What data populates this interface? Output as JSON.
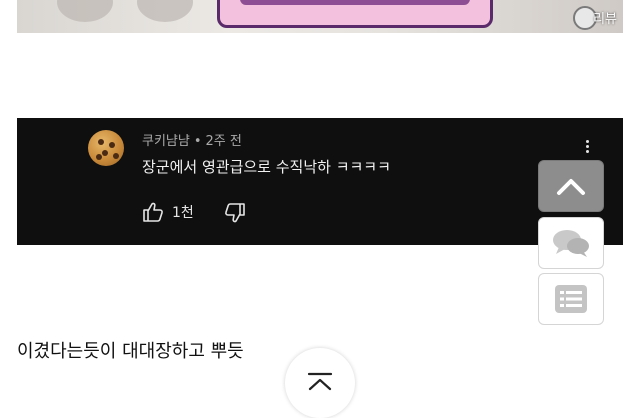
{
  "thumbnail": {
    "corner_text": "리뷰"
  },
  "comment": {
    "author": "쿠키냠냠",
    "separator": "•",
    "time": "2주 전",
    "text": "장군에서 영관급으로 수직낙하 ㅋㅋㅋㅋ",
    "likes": "1천",
    "avatar_icon": "cookie-avatar",
    "menu_icon": "more-vert-icon",
    "like_icon": "thumb-up-icon",
    "dislike_icon": "thumb-down-icon"
  },
  "side_buttons": [
    {
      "icon": "chevron-up-icon"
    },
    {
      "icon": "chat-bubbles-icon"
    },
    {
      "icon": "list-icon"
    }
  ],
  "caption": "이겼다는듯이 대대장하고 뿌듯",
  "scroll_top_icon": "double-chevron-up-icon",
  "colors": {
    "panel_bg": "#0f0f0f",
    "meta_text": "#aaaaaa",
    "comment_text": "#f1f1f1",
    "side_up_bg": "#8d8d8d"
  }
}
